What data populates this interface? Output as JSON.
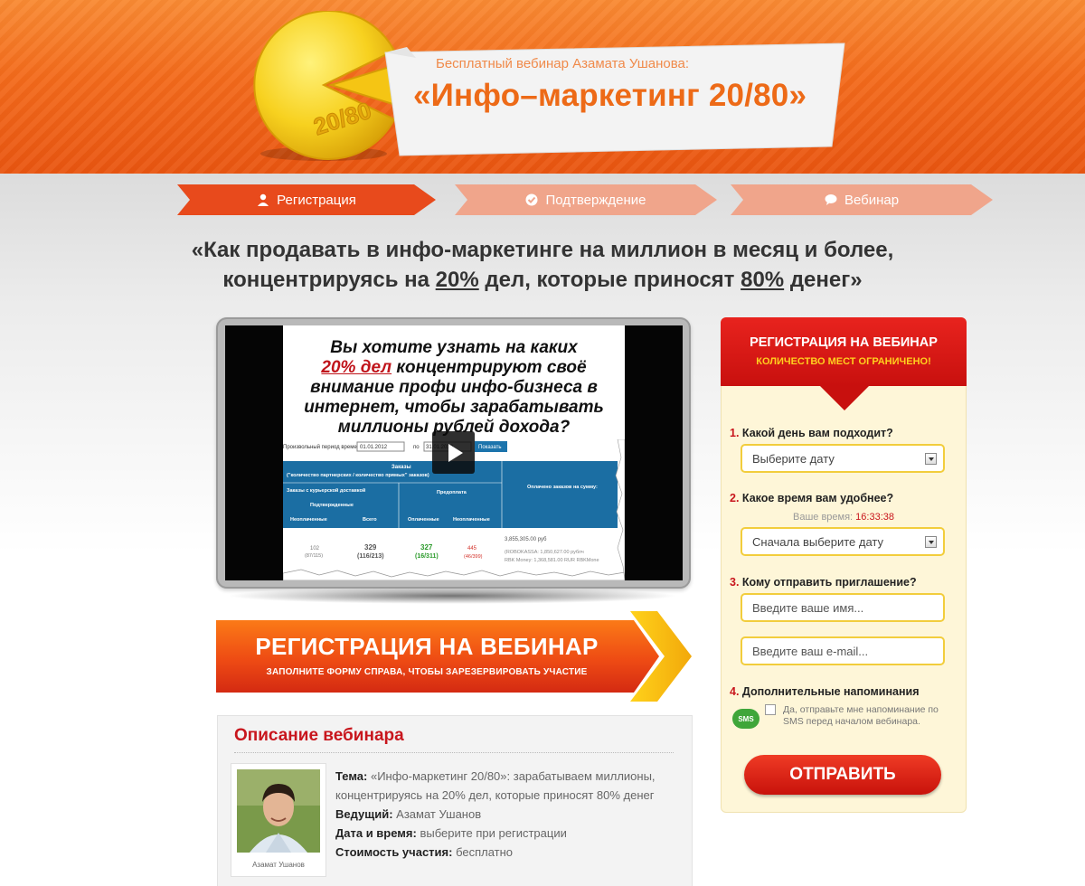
{
  "header": {
    "subtitle": "Бесплатный вебинар Азамата Ушанова:",
    "title": "«Инфо–маркетинг 20/80»",
    "logo_text": "20/80"
  },
  "steps": [
    {
      "label": "Регистрация",
      "icon": "user-icon",
      "active": true
    },
    {
      "label": "Подтверждение",
      "icon": "check-circle-icon",
      "active": false
    },
    {
      "label": "Вебинар",
      "icon": "chat-bubble-icon",
      "active": false
    }
  ],
  "headline": {
    "line1": "«Как продавать в инфо-маркетинге на миллион в месяц и более,",
    "line2_a": "концентрируясь на ",
    "line2_b": "20%",
    "line2_c": " дел, которые приносят ",
    "line2_d": "80%",
    "line2_e": " денег»"
  },
  "video": {
    "q1": "Вы хотите узнать на каких",
    "q2_red": "20% дел",
    "q2_rest": " концентрируют своё",
    "q3": "внимание профи инфо-бизнеса в",
    "q4": "интернет, чтобы зарабатывать",
    "q5": "миллионы рублей дохода?",
    "table": {
      "period_label": "Произвольный период времени: с",
      "date_from": "01.01.2012",
      "to_label": "по",
      "date_to": "31.01.2012",
      "show_button": "Показать",
      "orders_header": "Заказы",
      "orders_sub": "(\"количество партнерских / количество прямых\" заказов)",
      "courier_header": "Заказы с курьерской доставкой",
      "confirmed_header": "Подтвержденные",
      "unpaid_header": "Неоплаченные",
      "total_header": "Всего",
      "prepaid_header": "Предоплата",
      "paid_header": "Оплаченные",
      "unpaid2_header": "Неоплаченные",
      "sum_header": "Оплачено заказов на сумму:",
      "v1": "102",
      "v1b": "(87/115)",
      "v2": "329",
      "v2b": "(116/213)",
      "v3": "327",
      "v3b": "(16/311)",
      "v4": "445",
      "v4b": "(46/399)",
      "sum_total": "3,855,305.00 руб",
      "sum_rk": "(ROBOKASSA: 1,850,627.00 рублч",
      "sum_rbk": "RBK Money: 1,368,581.00 RUR RBKMone"
    }
  },
  "register_banner": {
    "title": "РЕГИСТРАЦИЯ НА ВЕБИНАР",
    "subtitle": "ЗАПОЛНИТЕ ФОРМУ СПРАВА, ЧТОБЫ ЗАРЕЗЕРВИРОВАТЬ УЧАСТИЕ"
  },
  "description": {
    "title": "Описание вебинара",
    "photo_caption": "Азамат Ушанов",
    "topic_label": "Тема:",
    "topic_value": " «Инфо-маркетинг 20/80»: зарабатываем миллионы, концентрируясь на 20% дел, которые приносят 80% денег",
    "host_label": "Ведущий:",
    "host_value": " Азамат Ушанов",
    "date_label": "Дата и время:",
    "date_value": " выберите при регистрации",
    "price_label": "Стоимость участия:",
    "price_value": " бесплатно"
  },
  "form": {
    "title": "РЕГИСТРАЦИЯ НА ВЕБИНАР",
    "subtitle": "КОЛИЧЕСТВО МЕСТ ОГРАНИЧЕНО!",
    "q1_num": "1.",
    "q1": " Какой день вам подходит?",
    "day_select": "Выберите дату",
    "q2_num": "2.",
    "q2": " Какое время вам удобнее?",
    "your_time_label": "Ваше время:",
    "your_time": "16:33:38",
    "time_select": "Сначала выберите дату",
    "q3_num": "3.",
    "q3": " Кому отправить приглашение?",
    "name_placeholder": "Введите ваше имя...",
    "email_placeholder": "Введите ваш e-mail...",
    "q4_num": "4.",
    "q4": " Дополнительные напоминания",
    "sms_badge": "SMS",
    "sms_text": "Да, отправьте мне напоминание по SMS перед началом вебинара.",
    "submit": "ОТПРАВИТЬ"
  },
  "colors": {
    "header_orange": "#f36a1b",
    "accent_red": "#c8161d",
    "form_bg": "#fef6d8",
    "field_border": "#f2cd3c"
  }
}
